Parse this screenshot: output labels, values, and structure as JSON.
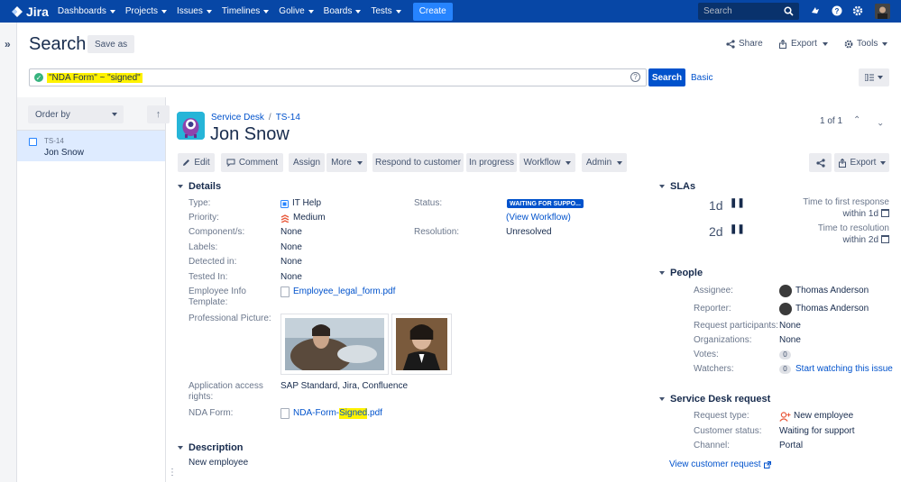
{
  "topnav": {
    "brand": "Jira",
    "items": [
      "Dashboards",
      "Projects",
      "Issues",
      "Timelines",
      "Golive",
      "Boards",
      "Tests"
    ],
    "create": "Create",
    "search_placeholder": "Search"
  },
  "page": {
    "title": "Search",
    "save_as": "Save as",
    "share": "Share",
    "export": "Export",
    "tools": "Tools"
  },
  "jql": {
    "query": "\"NDA Form\" ~ \"signed\"",
    "help": "?",
    "search_button": "Search",
    "basic_link": "Basic"
  },
  "results": {
    "order_by": "Order by",
    "sort_icon": "↑",
    "items": [
      {
        "key": "TS-14",
        "summary": "Jon Snow"
      }
    ]
  },
  "issue": {
    "breadcrumb": {
      "project": "Service Desk",
      "sep": "/",
      "key": "TS-14"
    },
    "title": "Jon Snow",
    "pager": "1 of 1",
    "toolbar": {
      "edit": "Edit",
      "comment": "Comment",
      "assign": "Assign",
      "more": "More",
      "respond": "Respond to customer",
      "in_progress": "In progress",
      "workflow": "Workflow",
      "admin": "Admin",
      "export": "Export"
    },
    "details": {
      "heading": "Details",
      "type_label": "Type:",
      "type_value": "IT Help",
      "priority_label": "Priority:",
      "priority_value": "Medium",
      "components_label": "Component/s:",
      "components_value": "None",
      "labels_label": "Labels:",
      "labels_value": "None",
      "detected_label": "Detected in:",
      "detected_value": "None",
      "tested_label": "Tested In:",
      "tested_value": "None",
      "template_label_1": "Employee Info",
      "template_label_2": "Template:",
      "template_value": "Employee_legal_form.pdf",
      "picture_label": "Professional Picture:",
      "app_access_label_1": "Application access",
      "app_access_label_2": "rights:",
      "app_access_value": "SAP Standard, Jira, Confluence",
      "nda_label": "NDA Form:",
      "nda_prefix": "NDA-Form-",
      "nda_highlight": "Signed",
      "nda_suffix": ".pdf",
      "status_label": "Status:",
      "status_value": "WAITING FOR SUPPO...",
      "view_workflow": "(View Workflow)",
      "resolution_label": "Resolution:",
      "resolution_value": "Unresolved"
    },
    "description": {
      "heading": "Description",
      "text": "New employee"
    },
    "slas": {
      "heading": "SLAs",
      "items": [
        {
          "remaining": "1d",
          "name": "Time to first response",
          "due": "within 1d"
        },
        {
          "remaining": "2d",
          "name": "Time to resolution",
          "due": "within 2d"
        }
      ]
    },
    "people": {
      "heading": "People",
      "assignee_label": "Assignee:",
      "assignee": "Thomas Anderson",
      "reporter_label": "Reporter:",
      "reporter": "Thomas Anderson",
      "participants_label": "Request participants:",
      "participants": "None",
      "orgs_label": "Organizations:",
      "orgs": "None",
      "votes_label": "Votes:",
      "votes": "0",
      "watchers_label": "Watchers:",
      "watchers": "0",
      "watch_link": "Start watching this issue"
    },
    "service_desk": {
      "heading": "Service Desk request",
      "type_label": "Request type:",
      "type": "New employee",
      "status_label": "Customer status:",
      "status": "Waiting for support",
      "channel_label": "Channel:",
      "channel": "Portal",
      "view_link": "View customer request"
    }
  },
  "colors": {
    "topbar": "#0747a6",
    "create": "#2684ff",
    "primary": "#0052cc",
    "highlight": "#fff200",
    "status_lozenge": "#0052cc"
  }
}
